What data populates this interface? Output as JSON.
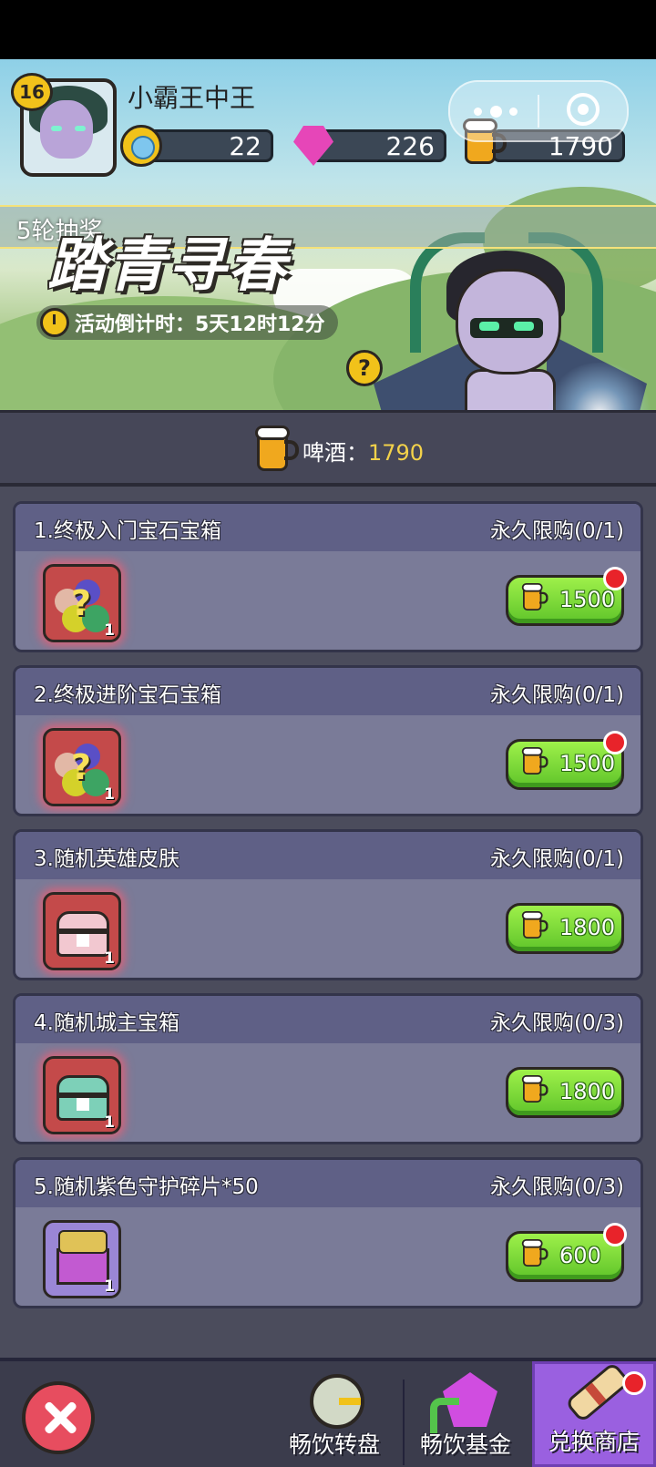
{
  "player": {
    "level": "16",
    "name": "小霸王中王"
  },
  "resources": {
    "coins": "22",
    "gems": "226",
    "beer": "1790"
  },
  "marquee": {
    "text": "5轮抽奖"
  },
  "event": {
    "title": "踏青寻春",
    "countdown_label": "活动倒计时：",
    "countdown_value": "5天12时12分",
    "help_label": "?"
  },
  "beer_bar": {
    "label": "啤酒：",
    "value": "1790"
  },
  "shop_items": [
    {
      "title": "1.终极入门宝石宝箱",
      "limit": "永久限购(0/1)",
      "count": "1",
      "price": "1500",
      "badge": true
    },
    {
      "title": "2.终极进阶宝石宝箱",
      "limit": "永久限购(0/1)",
      "count": "1",
      "price": "1500",
      "badge": true
    },
    {
      "title": "3.随机英雄皮肤",
      "limit": "永久限购(0/1)",
      "count": "1",
      "price": "1800",
      "badge": false
    },
    {
      "title": "4.随机城主宝箱",
      "limit": "永久限购(0/3)",
      "count": "1",
      "price": "1800",
      "badge": false
    },
    {
      "title": "5.随机紫色守护碎片*50",
      "limit": "永久限购(0/3)",
      "count": "1",
      "price": "600",
      "badge": true
    }
  ],
  "nav": {
    "tabs": [
      {
        "label": "畅饮转盘",
        "icon": "wheel-icon"
      },
      {
        "label": "畅饮基金",
        "icon": "fund-icon"
      },
      {
        "label": "兑换商店",
        "icon": "scroll-icon",
        "active": true
      }
    ]
  },
  "colors": {
    "card_bg": "#7a7b98",
    "card_head": "#5f6086",
    "price_button": "#7ad93a",
    "active_tab": "#9a60e0",
    "badge_red": "#e8232a"
  }
}
